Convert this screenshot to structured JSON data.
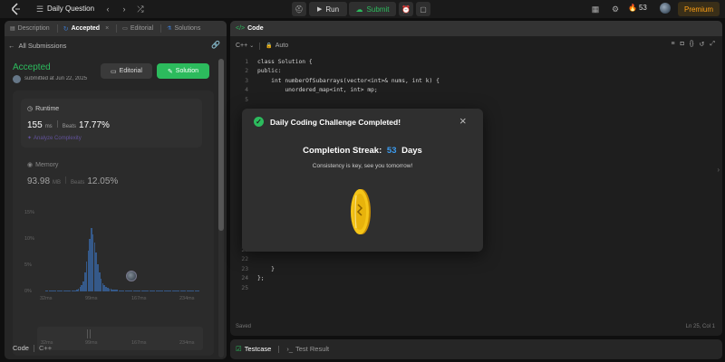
{
  "topbar": {
    "title": "Daily Question",
    "run_label": "Run",
    "submit_label": "Submit",
    "streak_count": "53",
    "premium_label": "Premium"
  },
  "left": {
    "tabs": [
      {
        "label": "Description"
      },
      {
        "label": "Accepted"
      },
      {
        "label": "Editorial"
      },
      {
        "label": "Solutions"
      }
    ],
    "all_submissions": "All Submissions",
    "status": "Accepted",
    "submitted": "submitted at Jun 22, 2025",
    "editorial_btn": "Editorial",
    "solution_btn": "Solution",
    "runtime": {
      "title": "Runtime",
      "value": "155",
      "unit": "ms",
      "beats_label": "Beats",
      "beats": "17.77%",
      "analyze": "Analyze Complexity"
    },
    "memory": {
      "title": "Memory",
      "value": "93.98",
      "unit": "MB",
      "beats_label": "Beats",
      "beats": "12.05%"
    },
    "yticks": [
      "15%",
      "10%",
      "5%",
      "0%"
    ],
    "xticks": [
      "32ms",
      "99ms",
      "167ms",
      "234ms"
    ],
    "xticks2": [
      "32ms",
      "99ms",
      "167ms",
      "234ms"
    ],
    "code_label": "Code",
    "lang_label": "C++"
  },
  "right": {
    "tab_title": "Code",
    "lang": "C++",
    "auto": "Auto",
    "status_saved": "Saved",
    "cursor": "Ln 25, Col 1",
    "testcase": "Testcase",
    "test_result": "Test Result",
    "code_top": [
      {
        "n": "1",
        "text": "class Solution {"
      },
      {
        "n": "2",
        "text": "public:"
      },
      {
        "n": "3",
        "text": "    int numberOfSubarrays(vector<int>& nums, int k) {"
      },
      {
        "n": "4",
        "text": "        unordered_map<int, int> mp;"
      },
      {
        "n": "5",
        "text": ""
      }
    ],
    "code_bottom": [
      {
        "n": "21",
        "text": ""
      },
      {
        "n": "22",
        "text": ""
      },
      {
        "n": "23",
        "text": "    }"
      },
      {
        "n": "24",
        "text": "};"
      },
      {
        "n": "25",
        "text": ""
      }
    ]
  },
  "modal": {
    "title": "Daily Coding Challenge Completed!",
    "streak_label": "Completion Streak:",
    "streak_value": "53",
    "streak_unit": "Days",
    "subtitle": "Consistency is key, see you tomorrow!"
  },
  "histogram": [
    1,
    1,
    1,
    1,
    1,
    1,
    1,
    1,
    1,
    1,
    1,
    1,
    1,
    1,
    1,
    1,
    1,
    1,
    1,
    2,
    3,
    5,
    8,
    12,
    22,
    35,
    48,
    62,
    75,
    68,
    58,
    46,
    32,
    22,
    15,
    10,
    7,
    5,
    4,
    3,
    3,
    2,
    2,
    2,
    2,
    1,
    1,
    1,
    1,
    1,
    1,
    1,
    1,
    1,
    1,
    1,
    1,
    1,
    1,
    1,
    1,
    1,
    1,
    1,
    1,
    1,
    1,
    1,
    1,
    1,
    1,
    1,
    1,
    1,
    1,
    1,
    1,
    1,
    1,
    1,
    1,
    1,
    1,
    1,
    1,
    1,
    1,
    1,
    1,
    1,
    1,
    1,
    1,
    1,
    1
  ],
  "colors": {
    "accent_green": "#2cbb5d",
    "accent_blue": "#3c78c8",
    "coin": "#f5c518"
  }
}
